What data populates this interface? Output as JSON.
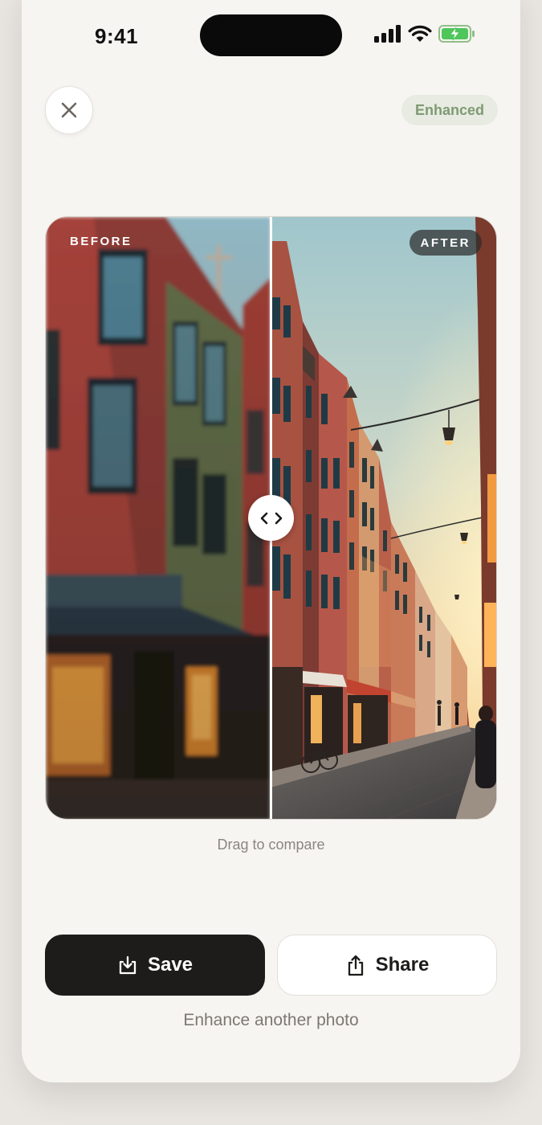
{
  "status_bar": {
    "time": "9:41",
    "icons": [
      "cellular-signal-icon",
      "wifi-icon",
      "battery-charging-icon"
    ]
  },
  "header": {
    "close_icon": "close-icon",
    "badge": "Enhanced"
  },
  "compare": {
    "before_label": "BEFORE",
    "after_label": "AFTER",
    "handle_icon": "chevron-left-right-icon",
    "hint": "Drag to compare"
  },
  "actions": {
    "save_label": "Save",
    "save_icon": "download-icon",
    "share_label": "Share",
    "share_icon": "share-icon",
    "secondary_link": "Enhance another photo"
  },
  "colors": {
    "background": "#f7f5f2",
    "primary_button": "#1d1c1a",
    "badge_bg": "#e7ebe1",
    "badge_text": "#7f9a74"
  }
}
